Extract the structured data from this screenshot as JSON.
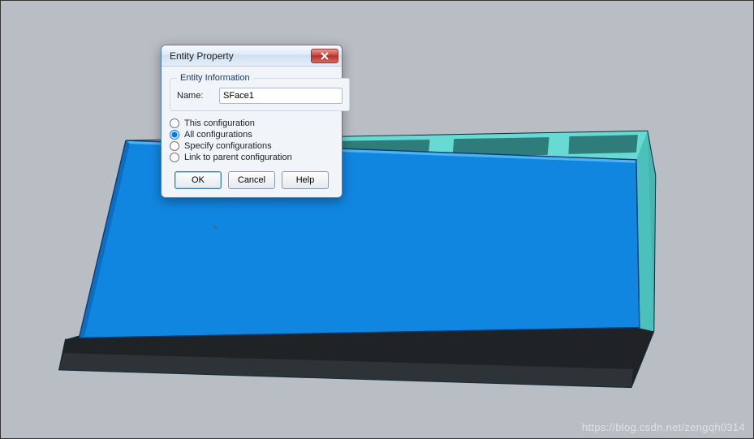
{
  "dialog": {
    "title": "Entity Property",
    "group_label": "Entity Information",
    "name_label": "Name:",
    "name_value": "SFace1",
    "options": {
      "this_cfg": "This configuration",
      "all_cfg": "All configurations",
      "spec_cfg": "Specify configurations",
      "link_parent": "Link to parent configuration",
      "selected": "all_cfg"
    },
    "buttons": {
      "ok": "OK",
      "cancel": "Cancel",
      "help": "Help"
    }
  },
  "watermark": "https://blog.csdn.net/zengqh0314"
}
